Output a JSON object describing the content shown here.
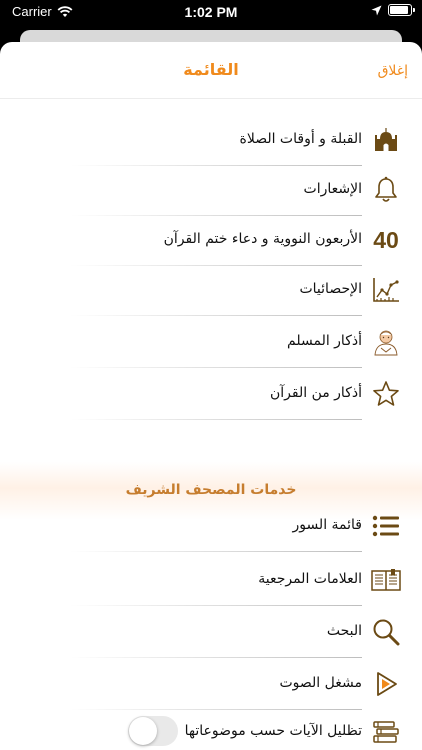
{
  "status_bar": {
    "carrier": "Carrier",
    "time": "1:02 PM"
  },
  "nav": {
    "title": "القائمة",
    "close_label": "إغلاق"
  },
  "menu_items": [
    {
      "label": "القبلة و أوقات الصلاة",
      "icon": "mosque-icon"
    },
    {
      "label": "الإشعارات",
      "icon": "bell-icon"
    },
    {
      "label": "الأربعون النووية و دعاء ختم القرآن",
      "icon": "number-40-icon",
      "badge": "40"
    },
    {
      "label": "الإحصائيات",
      "icon": "chart-icon"
    },
    {
      "label": "أذكار المسلم",
      "icon": "praying-person-icon"
    },
    {
      "label": "أذكار من القرآن",
      "icon": "star-icon"
    }
  ],
  "section": {
    "title": "خدمات المصحف الشريف"
  },
  "quran_items": [
    {
      "label": "قائمة السور",
      "icon": "list-icon"
    },
    {
      "label": "العلامات المرجعية",
      "icon": "book-icon"
    },
    {
      "label": "البحث",
      "icon": "search-icon"
    },
    {
      "label": "مشغل الصوت",
      "icon": "play-icon"
    },
    {
      "label": "تظليل الآيات حسب موضوعاتها",
      "icon": "books-stack-icon",
      "toggle_on": false
    }
  ],
  "colors": {
    "accent": "#f08a1c",
    "icon_brown": "#6b4a14",
    "section_title": "#c67d2e"
  }
}
